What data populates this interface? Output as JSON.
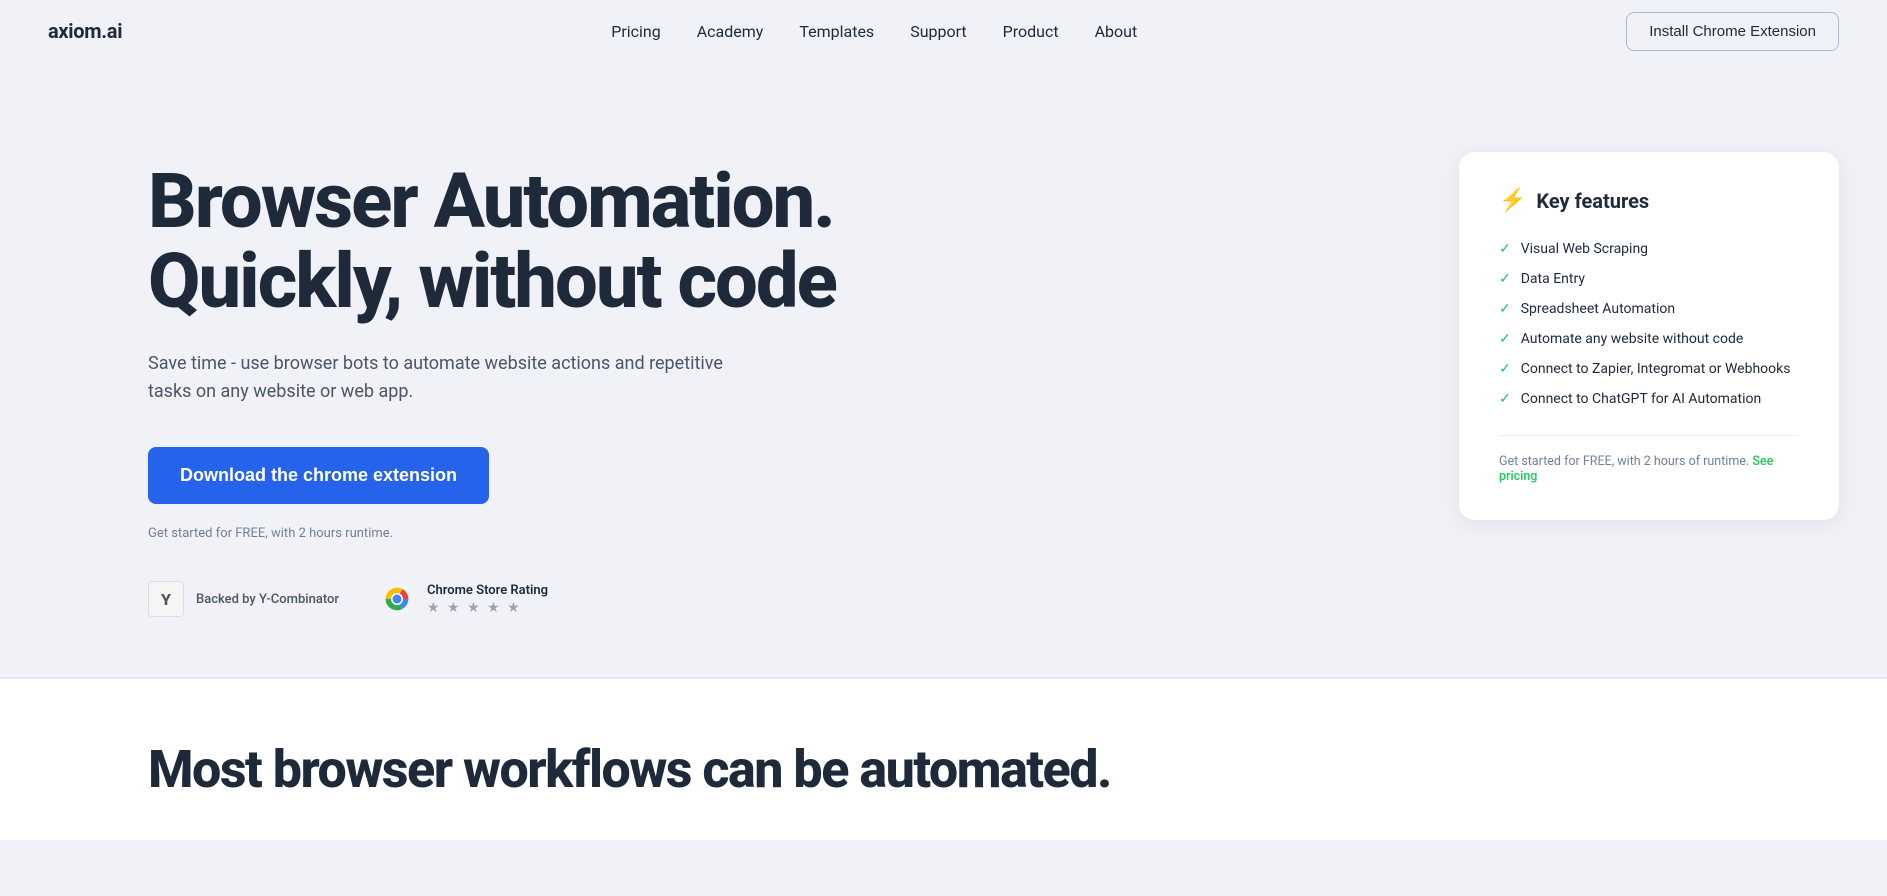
{
  "brand": {
    "logo": "axiom.ai"
  },
  "nav": {
    "links": [
      {
        "label": "Pricing",
        "id": "pricing"
      },
      {
        "label": "Academy",
        "id": "academy"
      },
      {
        "label": "Templates",
        "id": "templates"
      },
      {
        "label": "Support",
        "id": "support"
      },
      {
        "label": "Product",
        "id": "product"
      },
      {
        "label": "About",
        "id": "about"
      }
    ],
    "cta_label": "Install Chrome Extension"
  },
  "hero": {
    "title_line1": "Browser Automation.",
    "title_line2": "Quickly, without code",
    "subtitle": "Save time - use browser bots to automate website actions and repetitive tasks on any website or web app.",
    "cta_button": "Download the chrome extension",
    "cta_note": "Get started for FREE, with 2 hours runtime."
  },
  "features_card": {
    "title": "Key features",
    "icon": "⚡",
    "items": [
      "Visual Web Scraping",
      "Data Entry",
      "Spreadsheet Automation",
      "Automate any website without code",
      "Connect to Zapier, Integromat or Webhooks",
      "Connect to ChatGPT for AI Automation"
    ],
    "footer_text": "Get started for FREE, with 2 hours of runtime.",
    "footer_link_text": "See pricing"
  },
  "badges": {
    "yc": {
      "logo_text": "Y",
      "label": "Backed by Y-Combinator"
    },
    "chrome": {
      "title": "Chrome Store Rating",
      "stars": "★ ★ ★ ★ ★"
    }
  },
  "bottom_section": {
    "title": "Most browser workflows can be automated."
  }
}
